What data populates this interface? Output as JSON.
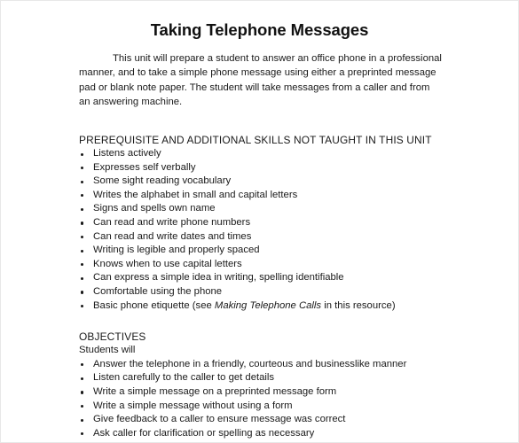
{
  "document": {
    "title": "Taking Telephone Messages",
    "intro": "This unit will prepare a student to answer an office phone in a professional manner, and to take a simple phone message using either a preprinted message pad or blank note paper. The student will take messages from a caller and from an answering machine.",
    "sections": [
      {
        "heading": "PREREQUISITE AND ADDITIONAL SKILLS NOT TAUGHT IN THIS UNIT",
        "items": [
          "Listens actively",
          "Expresses self verbally",
          "Some sight reading vocabulary",
          "Writes the alphabet in small and capital letters",
          "Signs and spells own name",
          "Can read and write phone numbers",
          "Can read and write dates and times",
          "Writing is legible and properly spaced",
          "Knows when to use capital letters",
          "Can express a simple idea in writing, spelling identifiable",
          "Comfortable using the phone"
        ],
        "last_item": {
          "prefix": "Basic phone etiquette (see ",
          "italic": "Making Telephone Calls",
          "suffix": " in this resource)"
        }
      },
      {
        "heading": "OBJECTIVES",
        "subnote": "Students will",
        "items": [
          "Answer the telephone in a friendly, courteous and businesslike manner",
          "Listen carefully to the caller to get details",
          "Write a simple message on a preprinted message form",
          "Write a simple message without using a form",
          "Give feedback to a caller to ensure message was correct",
          "Ask caller for clarification or spelling as necessary"
        ]
      }
    ]
  }
}
